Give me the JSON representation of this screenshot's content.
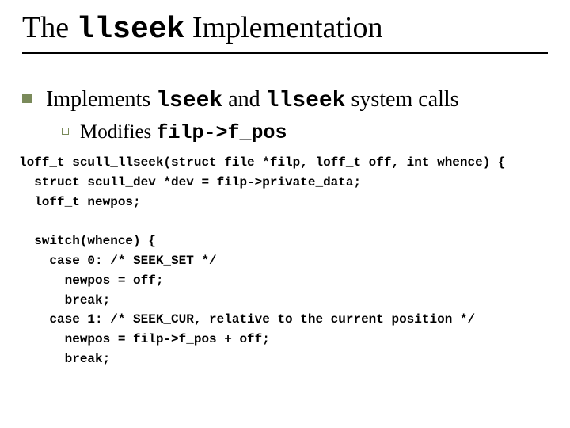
{
  "title": {
    "pre": "The ",
    "mono": "llseek",
    "post": " Implementation"
  },
  "bullet": {
    "pre": "Implements ",
    "mono1": "lseek",
    "mid": " and ",
    "mono2": "llseek",
    "post": " system calls"
  },
  "sub": {
    "pre": "Modifies ",
    "mono": "filp->f_pos"
  },
  "code": "loff_t scull_llseek(struct file *filp, loff_t off, int whence) {\n  struct scull_dev *dev = filp->private_data;\n  loff_t newpos;\n\n  switch(whence) {\n    case 0: /* SEEK_SET */\n      newpos = off;\n      break;\n    case 1: /* SEEK_CUR, relative to the current position */\n      newpos = filp->f_pos + off;\n      break;"
}
